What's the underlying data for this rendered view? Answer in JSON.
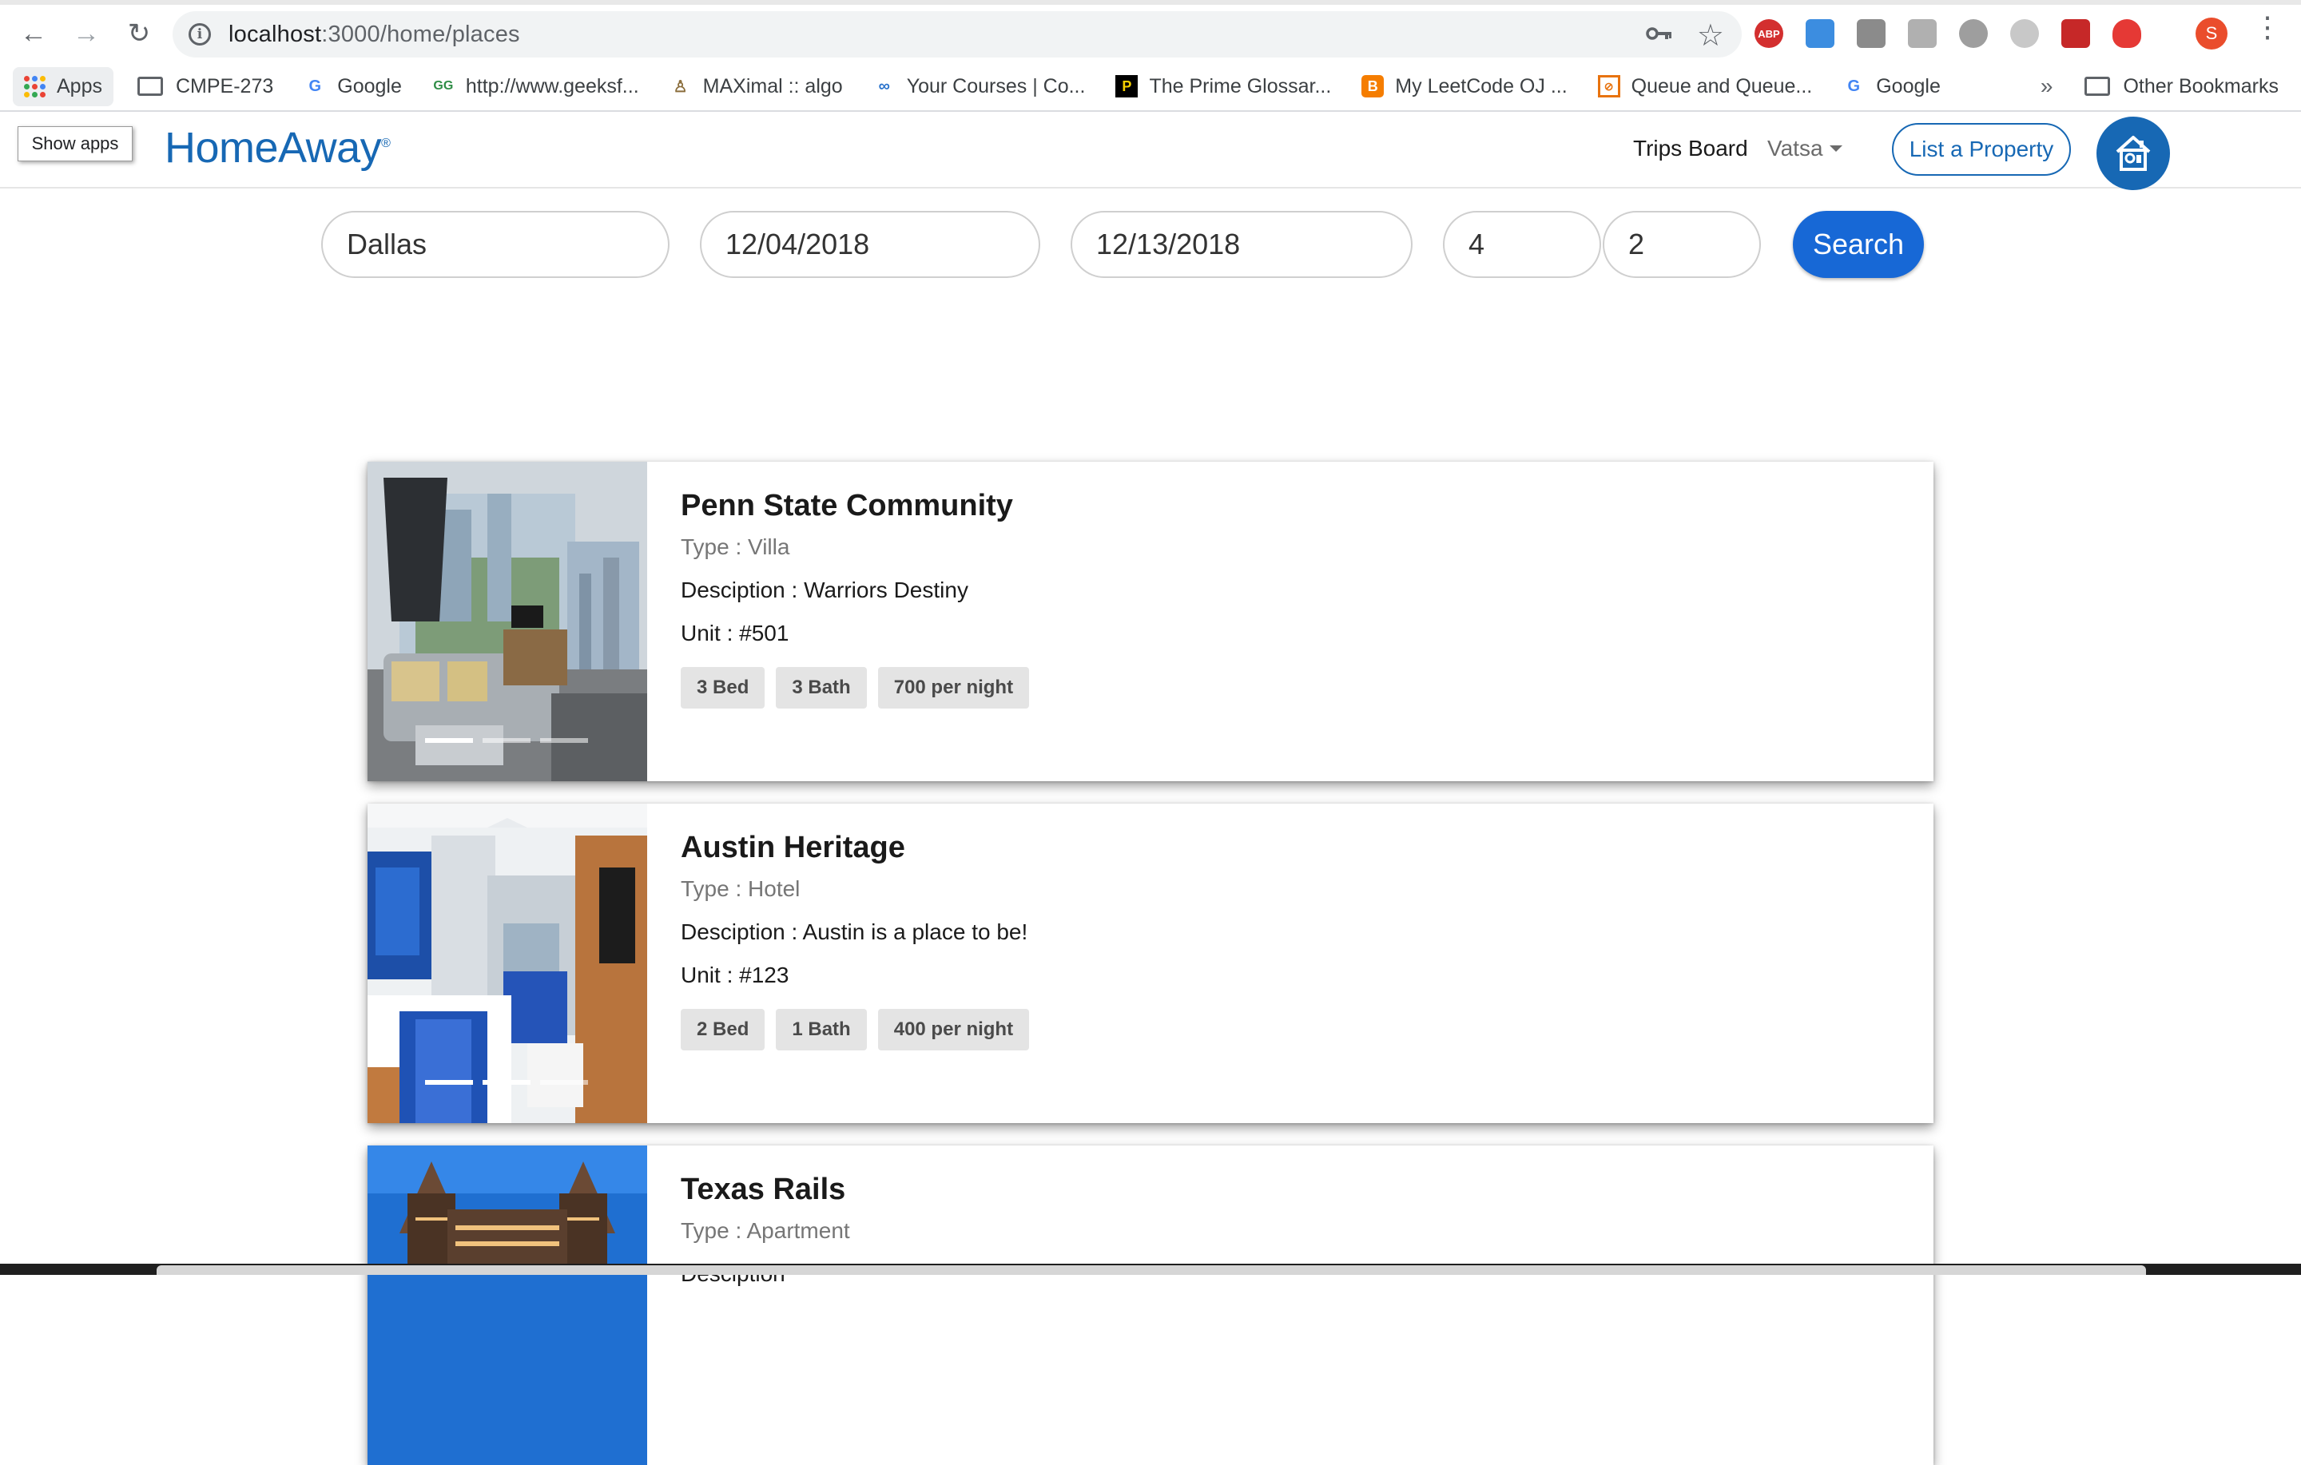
{
  "browser": {
    "url_host": "localhost",
    "url_path": ":3000/home/places",
    "profile_initial": "S",
    "ext_abp_label": "ABP",
    "bookmarks": [
      {
        "label": "Apps",
        "icon": "apps-grid-icon"
      },
      {
        "label": "CMPE-273",
        "icon": "folder-icon"
      },
      {
        "label": "Google",
        "icon": "google-icon"
      },
      {
        "label": "http://www.geeksf...",
        "icon": "geeksforgeeks-icon"
      },
      {
        "label": "MAXimal :: algo",
        "icon": "maximal-icon"
      },
      {
        "label": "Your Courses | Co...",
        "icon": "coursera-icon"
      },
      {
        "label": "The Prime Glossar...",
        "icon": "prime-icon"
      },
      {
        "label": "My LeetCode OJ ...",
        "icon": "blogger-icon"
      },
      {
        "label": "Queue and Queue...",
        "icon": "queue-icon"
      },
      {
        "label": "Google",
        "icon": "google-icon"
      }
    ],
    "bookmarks_more": "»",
    "other_bookmarks": "Other Bookmarks",
    "tooltip": "Show apps"
  },
  "site": {
    "logo": "HomeAway",
    "nav_trips": "Trips Board",
    "nav_user": "Vatsa",
    "list_property": "List a Property"
  },
  "search": {
    "city": "Dallas",
    "start_date": "12/04/2018",
    "end_date": "12/13/2018",
    "guests": "4",
    "bedrooms": "2",
    "button": "Search"
  },
  "listings": [
    {
      "title": "Penn State Community",
      "type": "Type : Villa",
      "description": "Desciption : Warriors Destiny",
      "unit": "Unit : #501",
      "beds": "3 Bed",
      "baths": "3 Bath",
      "price": "700 per night"
    },
    {
      "title": "Austin Heritage",
      "type": "Type : Hotel",
      "description": "Desciption : Austin is a place to be!",
      "unit": "Unit : #123",
      "beds": "2 Bed",
      "baths": "1 Bath",
      "price": "400 per night"
    },
    {
      "title": "Texas Rails",
      "type": "Type : Apartment",
      "description": "Desciption",
      "unit": "",
      "beds": "",
      "baths": "",
      "price": ""
    }
  ],
  "colors": {
    "brand_blue": "#1768b4",
    "search_blue": "#1768d6",
    "tag_bg": "#e4e4e4"
  }
}
